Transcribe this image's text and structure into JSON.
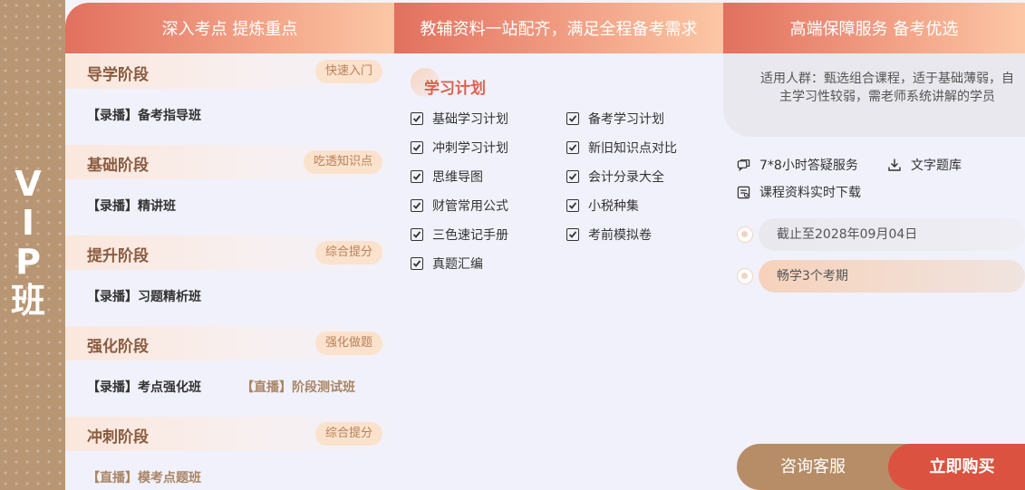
{
  "side_title": [
    "V",
    "I",
    "P",
    "班"
  ],
  "headers": [
    "深入考点 提炼重点",
    "教辅资料一站配齐，满足全程备考需求",
    "高端保障服务 备考优选"
  ],
  "stages": [
    {
      "name": "导学阶段",
      "tag": "快速入门",
      "courses": [
        "【录播】备考指导班"
      ]
    },
    {
      "name": "基础阶段",
      "tag": "吃透知识点",
      "courses": [
        "【录播】精讲班"
      ]
    },
    {
      "name": "提升阶段",
      "tag": "综合提分",
      "courses": [
        "【录播】习题精析班"
      ]
    },
    {
      "name": "强化阶段",
      "tag": "强化做题",
      "courses": [
        "【录播】考点强化班",
        "【直播】阶段测试班"
      ]
    },
    {
      "name": "冲刺阶段",
      "tag": "综合提分",
      "courses": [
        "【直播】模考点题班"
      ]
    }
  ],
  "plan": {
    "title": "学习计划",
    "items": [
      "基础学习计划",
      "备考学习计划",
      "冲刺学习计划",
      "新旧知识点对比",
      "思维导图",
      "会计分录大全",
      "财管常用公式",
      "小税种集",
      "三色速记手册",
      "考前模拟卷",
      "真题汇编"
    ]
  },
  "service": {
    "audience": "适用人群：甄选组合课程，适于基础薄弱，自主学习性较弱，需老师系统讲解的学员",
    "items": [
      "7*8小时答疑服务",
      "文字题库",
      "课程资料实时下载"
    ],
    "deadline": "截止至2028年09月04日",
    "duration": "畅学3个考期"
  },
  "buttons": {
    "consult": "咨询客服",
    "buy": "立即购买"
  },
  "colors": {
    "accent": "#e0604d",
    "buy": "#db5340",
    "consult": "#b68d67",
    "side": "#b89674"
  }
}
